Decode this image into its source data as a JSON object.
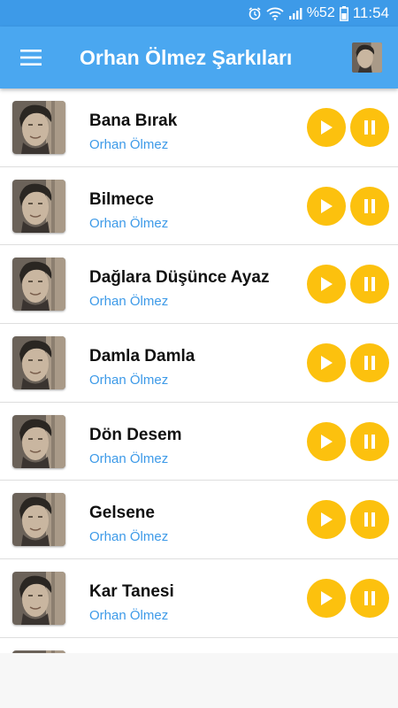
{
  "status": {
    "battery": "%52",
    "time": "11:54"
  },
  "header": {
    "title": "Orhan Ölmez Şarkıları"
  },
  "songs": [
    {
      "title": "Bana Bırak",
      "artist": "Orhan Ölmez"
    },
    {
      "title": "Bilmece",
      "artist": "Orhan Ölmez"
    },
    {
      "title": "Dağlara Düşünce Ayaz",
      "artist": "Orhan Ölmez"
    },
    {
      "title": "Damla Damla",
      "artist": "Orhan Ölmez"
    },
    {
      "title": "Dön Desem",
      "artist": "Orhan Ölmez"
    },
    {
      "title": "Gelsene",
      "artist": "Orhan Ölmez"
    },
    {
      "title": "Kar Tanesi",
      "artist": "Orhan Ölmez"
    },
    {
      "title": "",
      "artist": ""
    }
  ],
  "colors": {
    "status_bar": "#3d9ae8",
    "app_bar": "#4aa7f0",
    "button": "#fcc10e",
    "artist": "#3d9ae8"
  },
  "icons": {
    "menu": "menu-icon",
    "play": "play-icon",
    "pause": "pause-icon",
    "thumb": "artist-photo"
  }
}
